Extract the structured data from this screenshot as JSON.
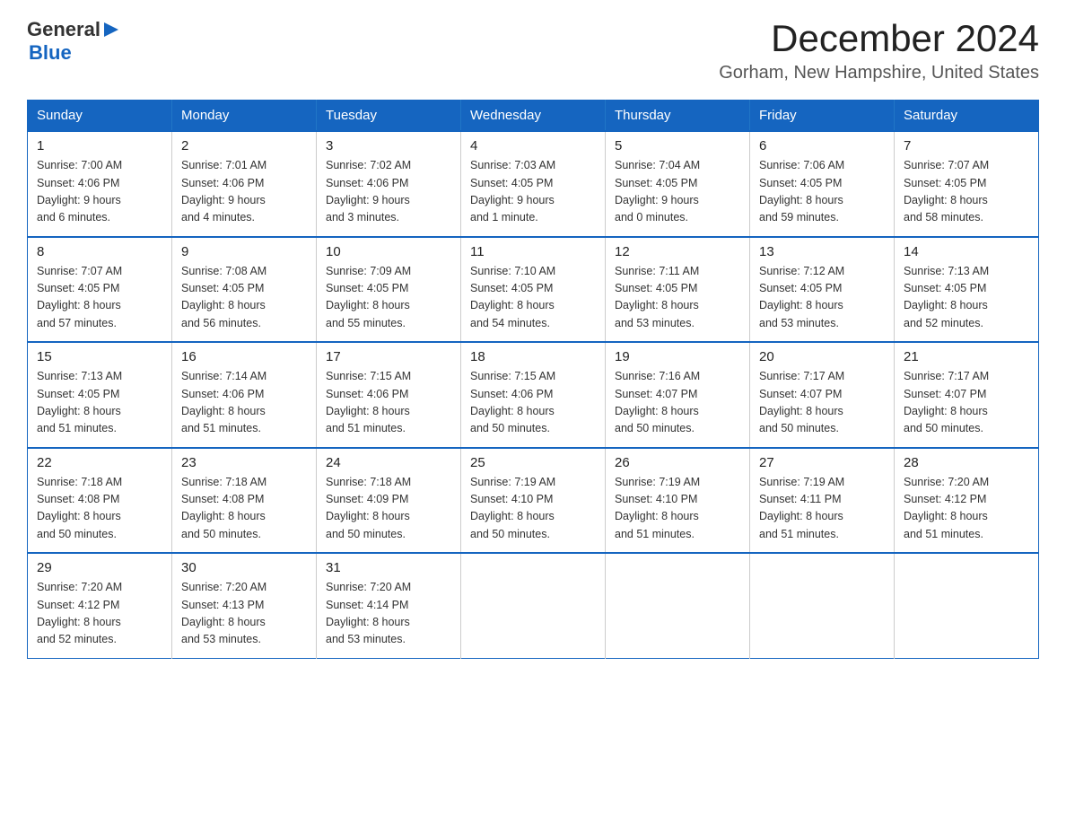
{
  "header": {
    "logo_general": "General",
    "logo_blue": "Blue",
    "title": "December 2024",
    "subtitle": "Gorham, New Hampshire, United States"
  },
  "days_of_week": [
    "Sunday",
    "Monday",
    "Tuesday",
    "Wednesday",
    "Thursday",
    "Friday",
    "Saturday"
  ],
  "weeks": [
    [
      {
        "day": "1",
        "sunrise": "7:00 AM",
        "sunset": "4:06 PM",
        "daylight": "9 hours and 6 minutes."
      },
      {
        "day": "2",
        "sunrise": "7:01 AM",
        "sunset": "4:06 PM",
        "daylight": "9 hours and 4 minutes."
      },
      {
        "day": "3",
        "sunrise": "7:02 AM",
        "sunset": "4:06 PM",
        "daylight": "9 hours and 3 minutes."
      },
      {
        "day": "4",
        "sunrise": "7:03 AM",
        "sunset": "4:05 PM",
        "daylight": "9 hours and 1 minute."
      },
      {
        "day": "5",
        "sunrise": "7:04 AM",
        "sunset": "4:05 PM",
        "daylight": "9 hours and 0 minutes."
      },
      {
        "day": "6",
        "sunrise": "7:06 AM",
        "sunset": "4:05 PM",
        "daylight": "8 hours and 59 minutes."
      },
      {
        "day": "7",
        "sunrise": "7:07 AM",
        "sunset": "4:05 PM",
        "daylight": "8 hours and 58 minutes."
      }
    ],
    [
      {
        "day": "8",
        "sunrise": "7:07 AM",
        "sunset": "4:05 PM",
        "daylight": "8 hours and 57 minutes."
      },
      {
        "day": "9",
        "sunrise": "7:08 AM",
        "sunset": "4:05 PM",
        "daylight": "8 hours and 56 minutes."
      },
      {
        "day": "10",
        "sunrise": "7:09 AM",
        "sunset": "4:05 PM",
        "daylight": "8 hours and 55 minutes."
      },
      {
        "day": "11",
        "sunrise": "7:10 AM",
        "sunset": "4:05 PM",
        "daylight": "8 hours and 54 minutes."
      },
      {
        "day": "12",
        "sunrise": "7:11 AM",
        "sunset": "4:05 PM",
        "daylight": "8 hours and 53 minutes."
      },
      {
        "day": "13",
        "sunrise": "7:12 AM",
        "sunset": "4:05 PM",
        "daylight": "8 hours and 53 minutes."
      },
      {
        "day": "14",
        "sunrise": "7:13 AM",
        "sunset": "4:05 PM",
        "daylight": "8 hours and 52 minutes."
      }
    ],
    [
      {
        "day": "15",
        "sunrise": "7:13 AM",
        "sunset": "4:05 PM",
        "daylight": "8 hours and 51 minutes."
      },
      {
        "day": "16",
        "sunrise": "7:14 AM",
        "sunset": "4:06 PM",
        "daylight": "8 hours and 51 minutes."
      },
      {
        "day": "17",
        "sunrise": "7:15 AM",
        "sunset": "4:06 PM",
        "daylight": "8 hours and 51 minutes."
      },
      {
        "day": "18",
        "sunrise": "7:15 AM",
        "sunset": "4:06 PM",
        "daylight": "8 hours and 50 minutes."
      },
      {
        "day": "19",
        "sunrise": "7:16 AM",
        "sunset": "4:07 PM",
        "daylight": "8 hours and 50 minutes."
      },
      {
        "day": "20",
        "sunrise": "7:17 AM",
        "sunset": "4:07 PM",
        "daylight": "8 hours and 50 minutes."
      },
      {
        "day": "21",
        "sunrise": "7:17 AM",
        "sunset": "4:07 PM",
        "daylight": "8 hours and 50 minutes."
      }
    ],
    [
      {
        "day": "22",
        "sunrise": "7:18 AM",
        "sunset": "4:08 PM",
        "daylight": "8 hours and 50 minutes."
      },
      {
        "day": "23",
        "sunrise": "7:18 AM",
        "sunset": "4:08 PM",
        "daylight": "8 hours and 50 minutes."
      },
      {
        "day": "24",
        "sunrise": "7:18 AM",
        "sunset": "4:09 PM",
        "daylight": "8 hours and 50 minutes."
      },
      {
        "day": "25",
        "sunrise": "7:19 AM",
        "sunset": "4:10 PM",
        "daylight": "8 hours and 50 minutes."
      },
      {
        "day": "26",
        "sunrise": "7:19 AM",
        "sunset": "4:10 PM",
        "daylight": "8 hours and 51 minutes."
      },
      {
        "day": "27",
        "sunrise": "7:19 AM",
        "sunset": "4:11 PM",
        "daylight": "8 hours and 51 minutes."
      },
      {
        "day": "28",
        "sunrise": "7:20 AM",
        "sunset": "4:12 PM",
        "daylight": "8 hours and 51 minutes."
      }
    ],
    [
      {
        "day": "29",
        "sunrise": "7:20 AM",
        "sunset": "4:12 PM",
        "daylight": "8 hours and 52 minutes."
      },
      {
        "day": "30",
        "sunrise": "7:20 AM",
        "sunset": "4:13 PM",
        "daylight": "8 hours and 53 minutes."
      },
      {
        "day": "31",
        "sunrise": "7:20 AM",
        "sunset": "4:14 PM",
        "daylight": "8 hours and 53 minutes."
      },
      null,
      null,
      null,
      null
    ]
  ]
}
